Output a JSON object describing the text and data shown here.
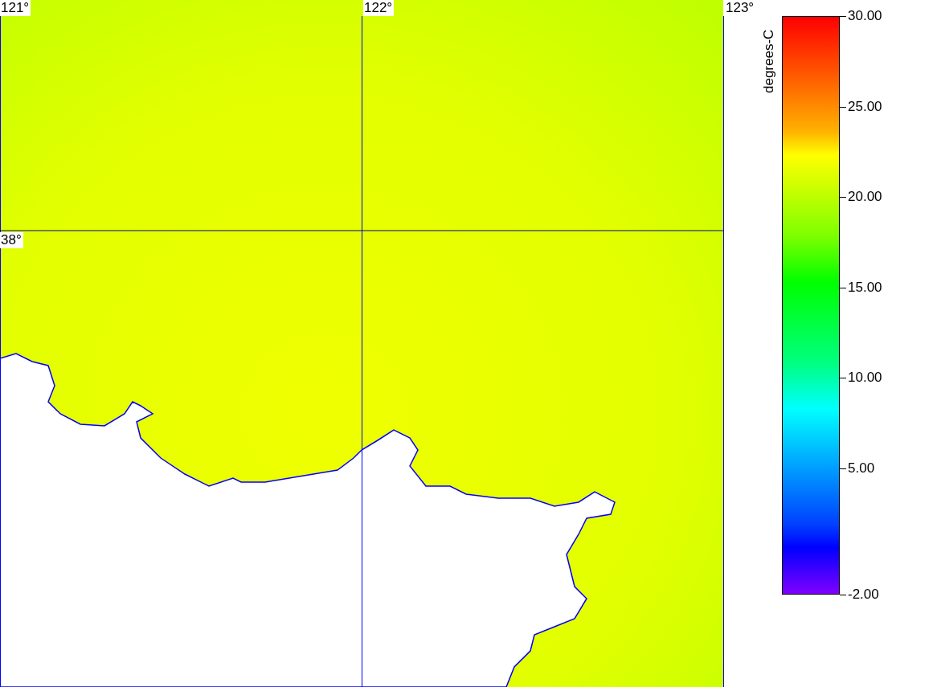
{
  "map": {
    "longitude_lines": [
      {
        "label": "121°"
      },
      {
        "label": "122°"
      },
      {
        "label": "123°"
      }
    ],
    "latitude_lines": [
      {
        "label": "38°"
      }
    ]
  },
  "legend": {
    "unit": "degrees-C",
    "ticks": [
      "30.00",
      "25.00",
      "20.00",
      "15.00",
      "10.00",
      "5.00",
      "-2.00"
    ]
  }
}
